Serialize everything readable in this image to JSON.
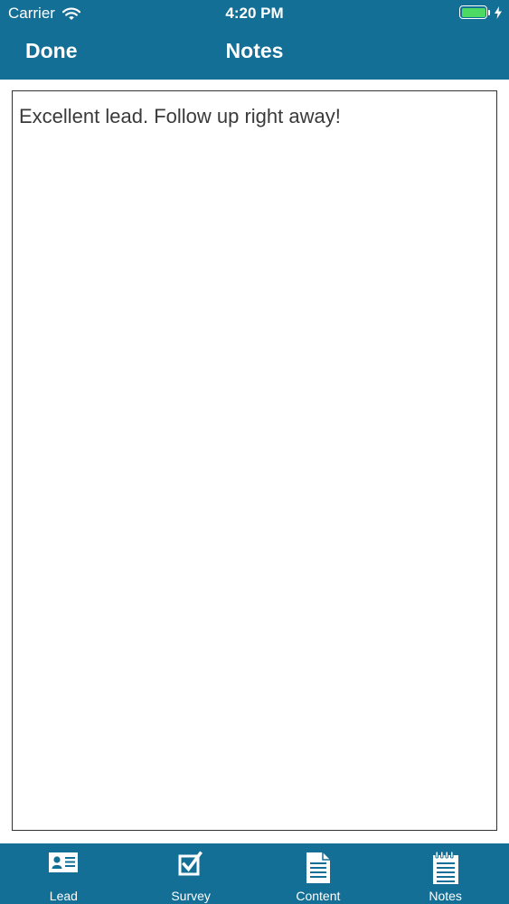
{
  "status_bar": {
    "carrier": "Carrier",
    "time": "4:20 PM",
    "wifi_icon": "wifi-icon",
    "battery_icon": "battery-icon",
    "charging_icon": "bolt-icon",
    "battery_level": 1.0
  },
  "nav": {
    "done_label": "Done",
    "title": "Notes"
  },
  "notes": {
    "text": "Excellent lead. Follow up right away!"
  },
  "tabs": [
    {
      "label": "Lead",
      "icon": "id-card-icon"
    },
    {
      "label": "Survey",
      "icon": "checkbox-icon"
    },
    {
      "label": "Content",
      "icon": "document-icon"
    },
    {
      "label": "Notes",
      "icon": "notepad-icon"
    }
  ],
  "colors": {
    "bar_background": "#136f96",
    "battery_fill": "#4cd964",
    "text": "#3a3a3a"
  }
}
